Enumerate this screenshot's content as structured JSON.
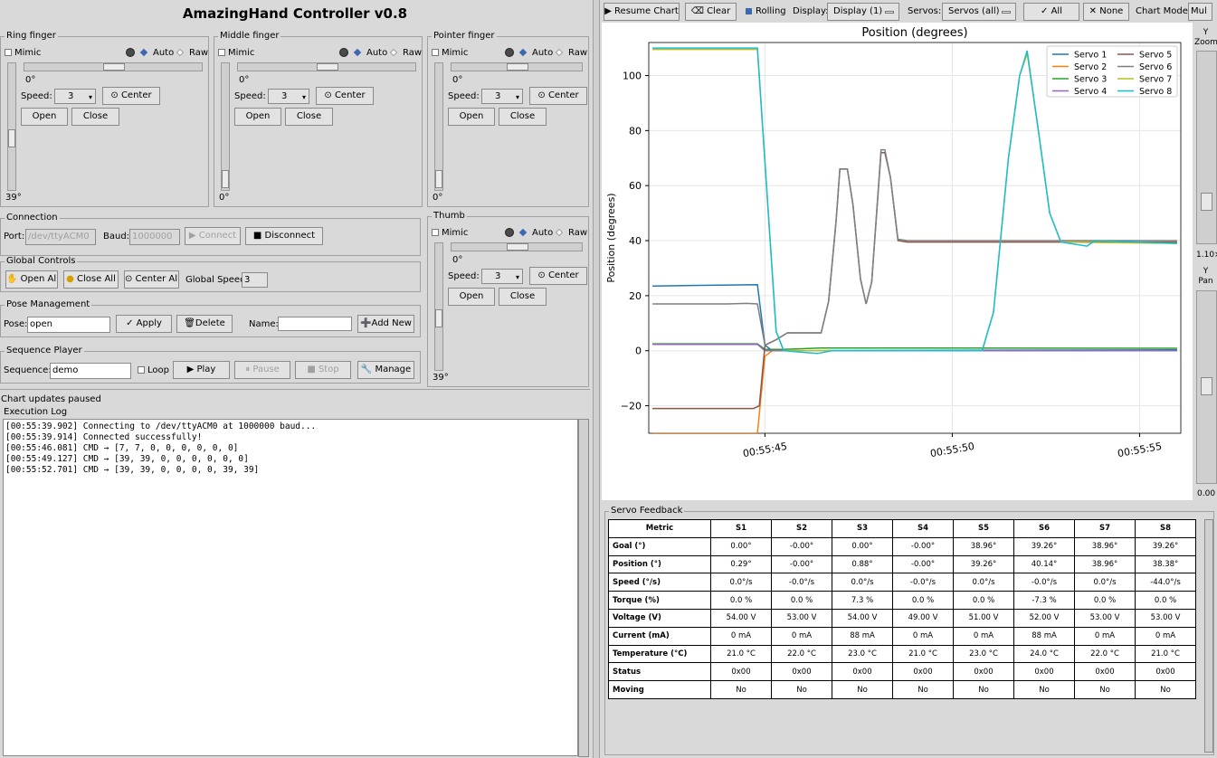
{
  "app_title": "AmazingHand Controller v0.8",
  "fingers": [
    {
      "name": "Ring finger",
      "mimic": "Mimic",
      "auto": "Auto",
      "raw": "Raw",
      "h_value": "0°",
      "v_value": "39°",
      "speed_label": "Speed:",
      "speed": "3",
      "center": "⊙ Center",
      "open": "Open",
      "close": "Close",
      "h_frac": 0.5,
      "v_frac": 0.38
    },
    {
      "name": "Middle finger",
      "mimic": "Mimic",
      "auto": "Auto",
      "raw": "Raw",
      "h_value": "0°",
      "v_value": "0°",
      "speed_label": "Speed:",
      "speed": "3",
      "center": "⊙ Center",
      "open": "Open",
      "close": "Close",
      "h_frac": 0.5,
      "v_frac": 0.0
    },
    {
      "name": "Pointer finger",
      "mimic": "Mimic",
      "auto": "Auto",
      "raw": "Raw",
      "h_value": "0°",
      "v_value": "0°",
      "speed_label": "Speed:",
      "speed": "3",
      "center": "⊙ Center",
      "open": "Open",
      "close": "Close",
      "h_frac": 0.5,
      "v_frac": 0.0
    },
    {
      "name": "Thumb",
      "mimic": "Mimic",
      "auto": "Auto",
      "raw": "Raw",
      "h_value": "0°",
      "v_value": "39°",
      "speed_label": "Speed:",
      "speed": "3",
      "center": "⊙ Center",
      "open": "Open",
      "close": "Close",
      "h_frac": 0.5,
      "v_frac": 0.38
    }
  ],
  "connection": {
    "title": "Connection",
    "port_label": "Port:",
    "port": "/dev/ttyACM0",
    "baud_label": "Baud:",
    "baud": "1000000",
    "connect": "▶ Connect",
    "disconnect": "■ Disconnect"
  },
  "global": {
    "title": "Global Controls",
    "open_all": "Open All",
    "close_all": "Close All",
    "center_all": "⊙ Center All",
    "speed_label": "Global Speed:",
    "speed": "3"
  },
  "pose": {
    "title": "Pose Management",
    "pose_label": "Pose:",
    "pose": "open",
    "apply": "✓ Apply",
    "delete": "Delete",
    "name_label": "Name:",
    "name_value": "",
    "add_new": "Add New"
  },
  "sequence": {
    "title": "Sequence Player",
    "seq_label": "Sequence:",
    "seq": "demo",
    "loop": "Loop",
    "play": "▶ Play",
    "pause": "⏸ Pause",
    "stop": "■ Stop",
    "manage": "Manage"
  },
  "status": "Chart updates paused",
  "log": {
    "title": "Execution Log",
    "lines": [
      "[00:55:39.902] Connecting to /dev/ttyACM0 at 1000000 baud...",
      "[00:55:39.914] Connected successfully!",
      "[00:55:46.081] CMD → [7, 7, 0, 0, 0, 0, 0, 0]",
      "[00:55:49.127] CMD → [39, 39, 0, 0, 0, 0, 0, 0]",
      "[00:55:52.701] CMD → [39, 39, 0, 0, 0, 0, 39, 39]"
    ]
  },
  "toolbar": {
    "resume": "▶ Resume Chart",
    "clear": "⌫ Clear",
    "rolling": "Rolling",
    "display_label": "Display:",
    "display": "Display (1)",
    "servos_label": "Servos:",
    "servos": "Servos (all)",
    "all": "✓ All",
    "none": "✕ None",
    "mode_label": "Chart Mode:",
    "mode": "Mul"
  },
  "side": {
    "y_zoom": "Y\nZoom",
    "zoom_val": "1.10×",
    "y_pan": "Y\nPan",
    "pan_val": "0.00"
  },
  "chart_data": {
    "type": "line",
    "title": "Position (degrees)",
    "ylabel": "Position (degrees)",
    "xlabel": "",
    "xlim": [
      41.9,
      56.1
    ],
    "ylim": [
      -30,
      112
    ],
    "yticks": [
      -20,
      0,
      20,
      40,
      60,
      80,
      100
    ],
    "xticks": [
      {
        "v": 45,
        "label": "00:55:45"
      },
      {
        "v": 50,
        "label": "00:55:50"
      },
      {
        "v": 55,
        "label": "00:55:55"
      }
    ],
    "grid": true,
    "legend": "top-right",
    "series": [
      {
        "name": "Servo 1",
        "color": "#1f77b4",
        "points": [
          [
            42,
            23.5
          ],
          [
            44.8,
            24
          ],
          [
            45.0,
            2
          ],
          [
            45.2,
            0
          ],
          [
            56,
            0.3
          ]
        ]
      },
      {
        "name": "Servo 2",
        "color": "#ff7f0e",
        "points": [
          [
            42,
            -30
          ],
          [
            44.8,
            -30
          ],
          [
            45.0,
            -2
          ],
          [
            45.2,
            0
          ],
          [
            56,
            0
          ]
        ]
      },
      {
        "name": "Servo 3",
        "color": "#2ca02c",
        "points": [
          [
            42,
            2.5
          ],
          [
            44.8,
            2.5
          ],
          [
            45.0,
            0.5
          ],
          [
            45.5,
            0.5
          ],
          [
            46.5,
            1
          ],
          [
            47.2,
            1
          ],
          [
            56,
            0.9
          ]
        ]
      },
      {
        "name": "Servo 4",
        "color": "#9467bd",
        "points": [
          [
            42,
            2.3
          ],
          [
            44.8,
            2.3
          ],
          [
            45.0,
            0
          ],
          [
            56,
            0
          ]
        ]
      },
      {
        "name": "Servo 5",
        "color": "#8c564b",
        "points": [
          [
            42,
            -21
          ],
          [
            44.7,
            -21
          ],
          [
            44.85,
            -20
          ],
          [
            45.0,
            2
          ],
          [
            45.3,
            4
          ],
          [
            45.6,
            6.5
          ],
          [
            46.5,
            6.5
          ],
          [
            46.7,
            18
          ],
          [
            46.9,
            47
          ],
          [
            47.0,
            66
          ],
          [
            47.2,
            66
          ],
          [
            47.35,
            53
          ],
          [
            47.55,
            26
          ],
          [
            47.7,
            17
          ],
          [
            47.85,
            25
          ],
          [
            48.1,
            72
          ],
          [
            48.2,
            72
          ],
          [
            48.35,
            63
          ],
          [
            48.55,
            40
          ],
          [
            48.8,
            39.5
          ],
          [
            56,
            39.5
          ]
        ]
      },
      {
        "name": "Servo 6",
        "color": "#7f7f7f",
        "points": [
          [
            42,
            17
          ],
          [
            44.0,
            17
          ],
          [
            44.5,
            17.2
          ],
          [
            44.8,
            17
          ],
          [
            45.0,
            2
          ],
          [
            45.3,
            4
          ],
          [
            45.6,
            6.5
          ],
          [
            46.5,
            6.5
          ],
          [
            46.7,
            18
          ],
          [
            46.9,
            47
          ],
          [
            47.0,
            66
          ],
          [
            47.2,
            66
          ],
          [
            47.35,
            53
          ],
          [
            47.55,
            26
          ],
          [
            47.7,
            17
          ],
          [
            47.85,
            25
          ],
          [
            48.1,
            73
          ],
          [
            48.2,
            73
          ],
          [
            48.35,
            63
          ],
          [
            48.55,
            40.5
          ],
          [
            48.8,
            40
          ],
          [
            56,
            40
          ]
        ]
      },
      {
        "name": "Servo 7",
        "color": "#bcbd22",
        "points": [
          [
            42,
            109.5
          ],
          [
            44.8,
            109.5
          ],
          [
            45.3,
            7
          ],
          [
            45.5,
            0
          ],
          [
            50.8,
            0
          ],
          [
            51.1,
            14
          ],
          [
            51.5,
            70
          ],
          [
            51.8,
            100
          ],
          [
            52.0,
            108
          ],
          [
            52.3,
            80
          ],
          [
            52.6,
            50
          ],
          [
            52.9,
            39.5
          ],
          [
            56,
            39
          ]
        ]
      },
      {
        "name": "Servo 8",
        "color": "#17becf",
        "points": [
          [
            42,
            110
          ],
          [
            44.8,
            110
          ],
          [
            45.3,
            7
          ],
          [
            45.5,
            0
          ],
          [
            46.4,
            -1
          ],
          [
            46.8,
            0
          ],
          [
            50.8,
            0
          ],
          [
            51.1,
            14
          ],
          [
            51.5,
            70
          ],
          [
            51.8,
            100
          ],
          [
            52.0,
            109
          ],
          [
            52.3,
            80
          ],
          [
            52.6,
            50
          ],
          [
            52.9,
            39.5
          ],
          [
            53.6,
            38
          ],
          [
            53.8,
            40
          ],
          [
            56,
            39
          ]
        ]
      }
    ]
  },
  "feedback": {
    "title": "Servo Feedback",
    "headers": [
      "Metric",
      "S1",
      "S2",
      "S3",
      "S4",
      "S5",
      "S6",
      "S7",
      "S8"
    ],
    "rows": [
      [
        "Goal (°)",
        "0.00°",
        "-0.00°",
        "0.00°",
        "-0.00°",
        "38.96°",
        "39.26°",
        "38.96°",
        "39.26°"
      ],
      [
        "Position (°)",
        "0.29°",
        "-0.00°",
        "0.88°",
        "-0.00°",
        "39.26°",
        "40.14°",
        "38.96°",
        "38.38°"
      ],
      [
        "Speed (°/s)",
        "0.0°/s",
        "-0.0°/s",
        "0.0°/s",
        "-0.0°/s",
        "0.0°/s",
        "-0.0°/s",
        "0.0°/s",
        "-44.0°/s"
      ],
      [
        "Torque (%)",
        "0.0 %",
        "0.0 %",
        "7.3 %",
        "0.0 %",
        "0.0 %",
        "-7.3 %",
        "0.0 %",
        "0.0 %"
      ],
      [
        "Voltage (V)",
        "54.00 V",
        "53.00 V",
        "54.00 V",
        "49.00 V",
        "51.00 V",
        "52.00 V",
        "53.00 V",
        "53.00 V"
      ],
      [
        "Current (mA)",
        "0 mA",
        "0 mA",
        "88 mA",
        "0 mA",
        "0 mA",
        "88 mA",
        "0 mA",
        "0 mA"
      ],
      [
        "Temperature (°C)",
        "21.0 °C",
        "22.0 °C",
        "23.0 °C",
        "21.0 °C",
        "23.0 °C",
        "24.0 °C",
        "22.0 °C",
        "21.0 °C"
      ],
      [
        "Status",
        "0x00",
        "0x00",
        "0x00",
        "0x00",
        "0x00",
        "0x00",
        "0x00",
        "0x00"
      ],
      [
        "Moving",
        "No",
        "No",
        "No",
        "No",
        "No",
        "No",
        "No",
        "No"
      ]
    ]
  }
}
